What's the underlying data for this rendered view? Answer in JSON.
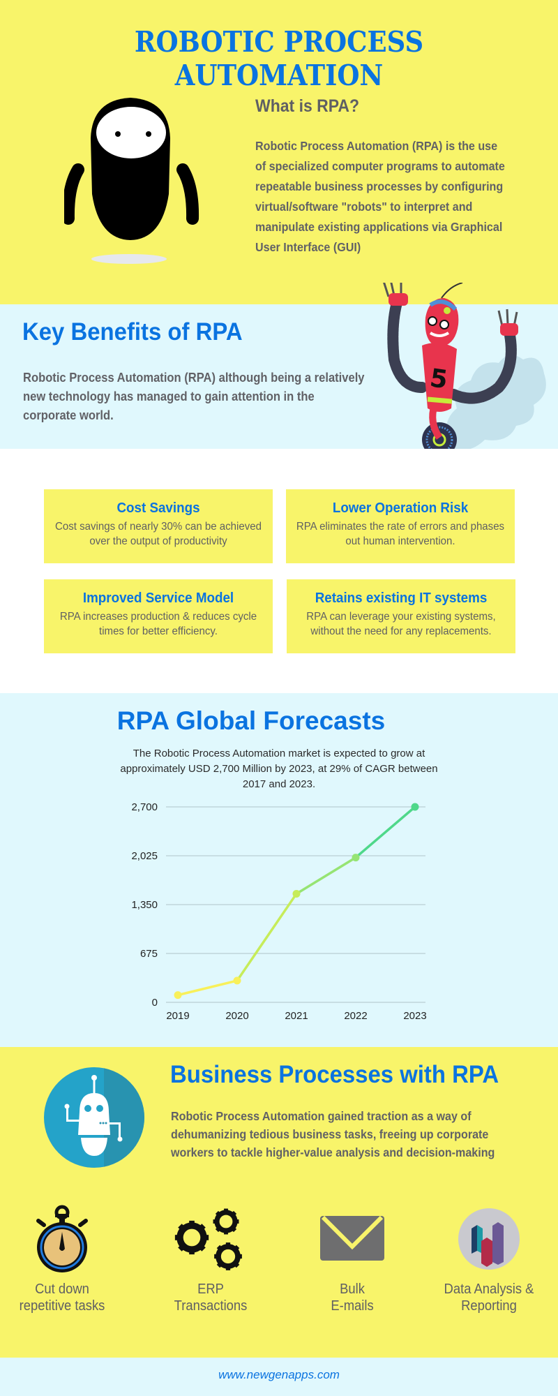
{
  "header": {
    "title": "ROBOTIC PROCESS AUTOMATION"
  },
  "what_is": {
    "heading": "What is RPA?",
    "body": "Robotic Process Automation (RPA) is the use of specialized computer programs to automate repeatable business processes by configuring virtual/software \"robots\" to interpret and manipulate existing applications via Graphical User Interface (GUI)"
  },
  "key_benefits": {
    "heading": "Key Benefits of RPA",
    "body": "Robotic Process Automation (RPA) although being a relatively new technology has managed to gain attention in the corporate world.",
    "cards": [
      {
        "title": "Cost Savings",
        "desc": "Cost savings of nearly 30% can be achieved over the output of productivity"
      },
      {
        "title": "Lower Operation Risk",
        "desc": "RPA eliminates the rate of errors and phases out human intervention."
      },
      {
        "title": "Improved Service Model",
        "desc": "RPA increases production & reduces cycle times for better efficiency."
      },
      {
        "title": "Retains existing IT systems",
        "desc": "RPA can leverage your existing systems, without the need for any replacements."
      }
    ]
  },
  "forecast": {
    "heading": "RPA Global Forecasts",
    "body": "The Robotic Process Automation market is expected to grow at approximately USD 2,700 Million by 2023, at 29% of CAGR between 2017 and 2023."
  },
  "chart_data": {
    "type": "line",
    "title": "",
    "xlabel": "",
    "ylabel": "",
    "categories": [
      "2019",
      "2020",
      "2021",
      "2022",
      "2023"
    ],
    "values": [
      100,
      300,
      1500,
      2000,
      2700
    ],
    "ylim": [
      0,
      2700
    ],
    "yticks": [
      0,
      675,
      1350,
      2025,
      2700
    ],
    "ytick_labels": [
      "0",
      "675",
      "1,350",
      "2,025",
      "2,700"
    ],
    "grid": true,
    "legend": "none",
    "point_colors": [
      "#f8f05a",
      "#f8f05a",
      "#c6ec5a",
      "#96e473",
      "#4fd88a"
    ]
  },
  "business": {
    "heading": "Business Processes with RPA",
    "body": "Robotic Process Automation gained traction as a way of dehumanizing tedious business tasks, freeing up corporate workers to tackle higher-value analysis and decision-making",
    "processes": [
      {
        "icon": "stopwatch-icon",
        "line1": "Cut down",
        "line2": "repetitive tasks"
      },
      {
        "icon": "gears-icon",
        "line1": "ERP",
        "line2": "Transactions"
      },
      {
        "icon": "envelope-icon",
        "line1": "Bulk",
        "line2": "E-mails"
      },
      {
        "icon": "bar-chart-icon",
        "line1": "Data Analysis &",
        "line2": "Reporting"
      }
    ]
  },
  "footer": {
    "link": "www.newgenapps.com"
  },
  "colors": {
    "yellow": "#f8f46a",
    "light_blue": "#e0f8fd",
    "brand_blue": "#0a73e0",
    "text_gray": "#616166"
  }
}
